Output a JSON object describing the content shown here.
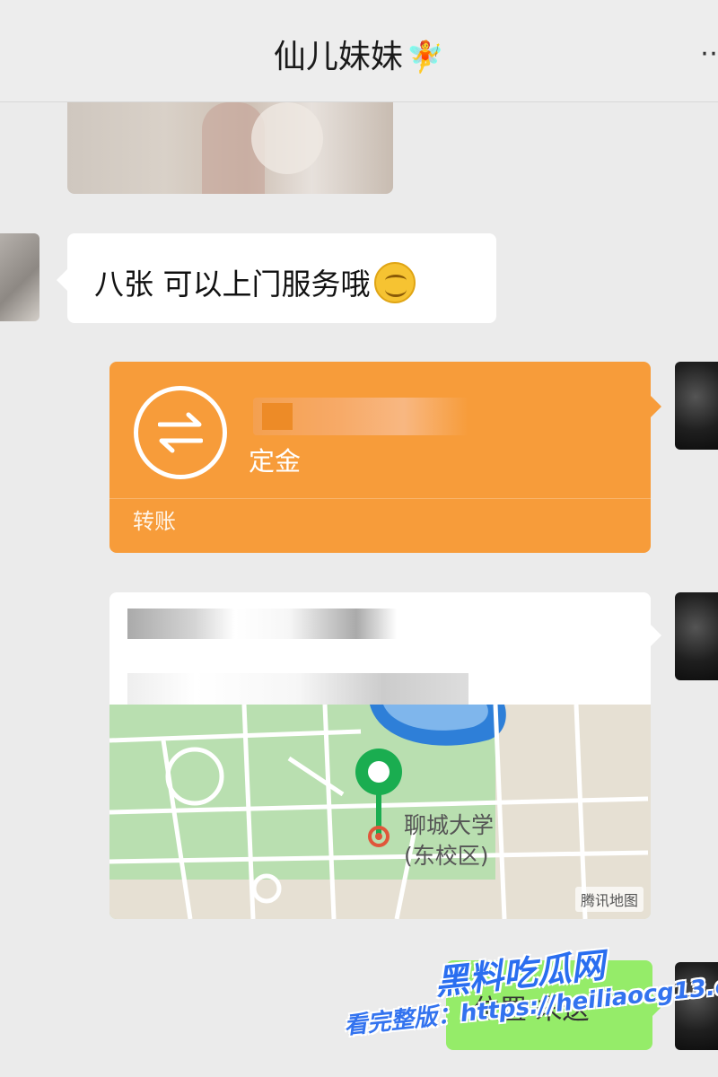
{
  "header": {
    "title": "仙儿妹妹",
    "title_emoji": "🧚",
    "more_icon": "more-icon"
  },
  "messages": {
    "text_message": "八张 可以上门服务哦",
    "text_emoji": "smile-icon",
    "transfer": {
      "description": "定金",
      "type_label": "转账",
      "icon": "transfer-arrows-icon",
      "color": "#f79c3a"
    },
    "location": {
      "map_label_line1": "聊城大学",
      "map_label_line2": "(东校区)",
      "map_provider": "腾讯地图"
    },
    "sent_text": "位置 未送"
  },
  "watermark": {
    "title": "黑料吃瓜网",
    "url": "看完整版：https://heiliaocg13.com"
  },
  "colors": {
    "background": "#ebebeb",
    "sent_bubble": "#95ec69",
    "map_green": "#b9dfb0",
    "pin_green": "#1aad50"
  }
}
